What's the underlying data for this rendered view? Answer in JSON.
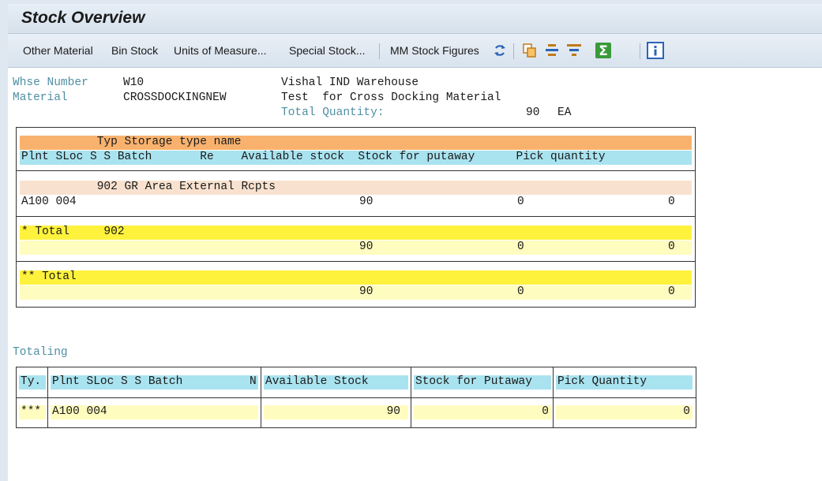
{
  "window": {
    "title": "Stock Overview"
  },
  "toolbar": {
    "buttons": [
      "Other Material",
      "Bin Stock",
      "Units of Measure...",
      "Special Stock...",
      "MM Stock Figures"
    ],
    "icons": [
      "refresh-icon",
      "copy-icon",
      "align-center-icon",
      "filter-icon",
      "sum-icon",
      "info-icon"
    ]
  },
  "header": {
    "whse_label": "Whse Number",
    "whse_value": "W10",
    "whse_desc": "Vishal IND Warehouse",
    "material_label": "Material",
    "material_value": "CROSSDOCKINGNEW",
    "material_desc": "Test  for Cross Docking Material",
    "total_qty_label": "Total Quantity:",
    "total_qty_value": "90",
    "total_qty_unit": "EA"
  },
  "stock_table": {
    "header1": "           Typ Storage type name",
    "header2": "Plnt SLoc S S Batch       Re    Available stock  Stock for putaway      Pick quantity",
    "group_title": "           902 GR Area External Rcpts",
    "detail_left": "A100 004",
    "detail_avail": "90",
    "detail_putaway": "0",
    "detail_pick": "0",
    "subtotal_title": "* Total     902",
    "subtotal_avail": "90",
    "subtotal_putaway": "0",
    "subtotal_pick": "0",
    "grandtotal_title": "** Total",
    "grandtotal_avail": "90",
    "grandtotal_putaway": "0",
    "grandtotal_pick": "0"
  },
  "totaling": {
    "label": "Totaling",
    "col_ty": "Ty.",
    "col_plnt": "Plnt SLoc S S Batch",
    "col_n": "N",
    "col_avail": "Available Stock",
    "col_putaway": "Stock for Putaway",
    "col_pick": "Pick Quantity",
    "row_ty": "***",
    "row_plnt": "A100 004",
    "row_avail": "90",
    "row_putaway": "0",
    "row_pick": "0"
  }
}
